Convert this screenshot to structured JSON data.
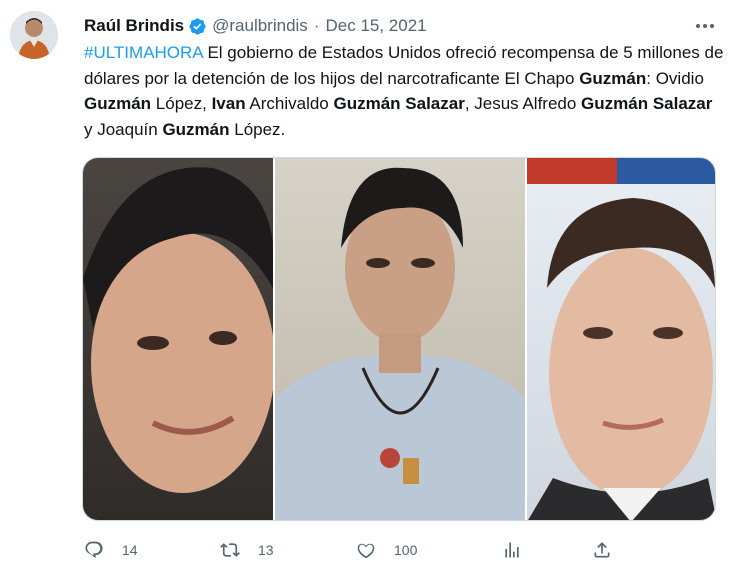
{
  "tweet": {
    "author_name": "Raúl Brindis",
    "handle": "@raulbrindis",
    "separator": "·",
    "date": "Dec 15, 2021",
    "text_parts": [
      {
        "t": "#ULTIMAHORA",
        "style": "tag"
      },
      {
        "t": " El gobierno de Estados Unidos ofreció recompensa de 5 millones de dólares por la detención de los hijos del narcotraficante El Chapo ",
        "style": "normal"
      },
      {
        "t": "Guzmán",
        "style": "bold"
      },
      {
        "t": ": Ovidio ",
        "style": "normal"
      },
      {
        "t": "Guzmán",
        "style": "bold"
      },
      {
        "t": " López, ",
        "style": "normal"
      },
      {
        "t": "Ivan",
        "style": "bold"
      },
      {
        "t": " Archivaldo ",
        "style": "normal"
      },
      {
        "t": "Guzmán Salazar",
        "style": "bold"
      },
      {
        "t": ", Jesus Alfredo ",
        "style": "normal"
      },
      {
        "t": "Guzmán Salazar",
        "style": "bold"
      },
      {
        "t": " y Joaquín ",
        "style": "normal"
      },
      {
        "t": "Guzmán",
        "style": "bold"
      },
      {
        "t": " López.",
        "style": "normal"
      }
    ]
  },
  "actions": {
    "reply_count": "14",
    "retweet_count": "13",
    "like_count": "100"
  },
  "colors": {
    "accent": "#1d9bf0",
    "text": "#0f1419",
    "muted": "#536471",
    "border": "#cfd9de"
  },
  "icons": {
    "verified": "verified-badge-icon",
    "more": "more-dots-icon",
    "reply": "reply-bubble-icon",
    "retweet": "retweet-arrows-icon",
    "like": "heart-icon",
    "analytics": "bar-chart-icon",
    "share": "share-upload-icon"
  }
}
